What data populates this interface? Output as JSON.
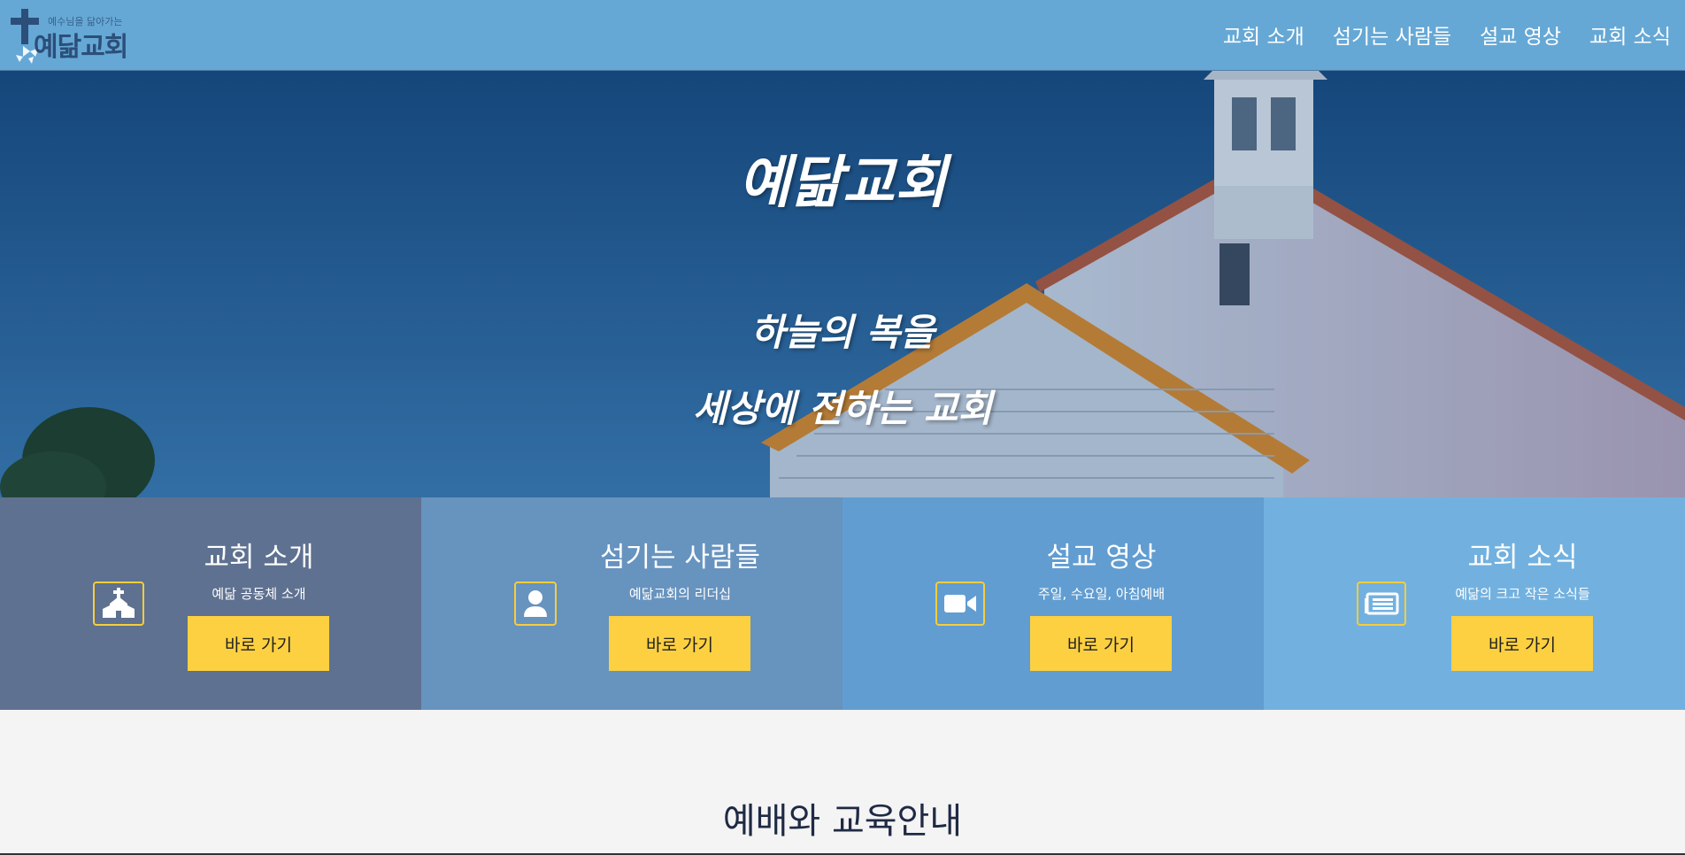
{
  "header": {
    "logo_tagline": "예수님을 닮아가는",
    "logo_name": "예닮교회",
    "nav": [
      "교회 소개",
      "섬기는 사람들",
      "설교 영상",
      "교회 소식"
    ]
  },
  "hero": {
    "title": "예닮교회",
    "subtitle_line1": "하늘의 복을",
    "subtitle_line2": "세상에 전하는 교회"
  },
  "cards": [
    {
      "title": "교회 소개",
      "desc": "예닮 공동체 소개",
      "button": "바로 가기",
      "icon": "church-icon",
      "bg": "#5f7190"
    },
    {
      "title": "섬기는 사람들",
      "desc": "예닮교회의 리더십",
      "button": "바로 가기",
      "icon": "person-icon",
      "bg": "#6793bf"
    },
    {
      "title": "설교 영상",
      "desc": "주일, 수요일, 아침예배",
      "button": "바로 가기",
      "icon": "video-camera-icon",
      "bg": "#619dd1"
    },
    {
      "title": "교회 소식",
      "desc": "예닮의 크고 작은 소식들",
      "button": "바로 가기",
      "icon": "newspaper-icon",
      "bg": "#72b1df"
    }
  ],
  "section": {
    "title": "예배와 교육안내"
  },
  "colors": {
    "header_bg": "#66a8d5",
    "accent_yellow": "#fcd040",
    "text_dark": "#1f2a44"
  }
}
